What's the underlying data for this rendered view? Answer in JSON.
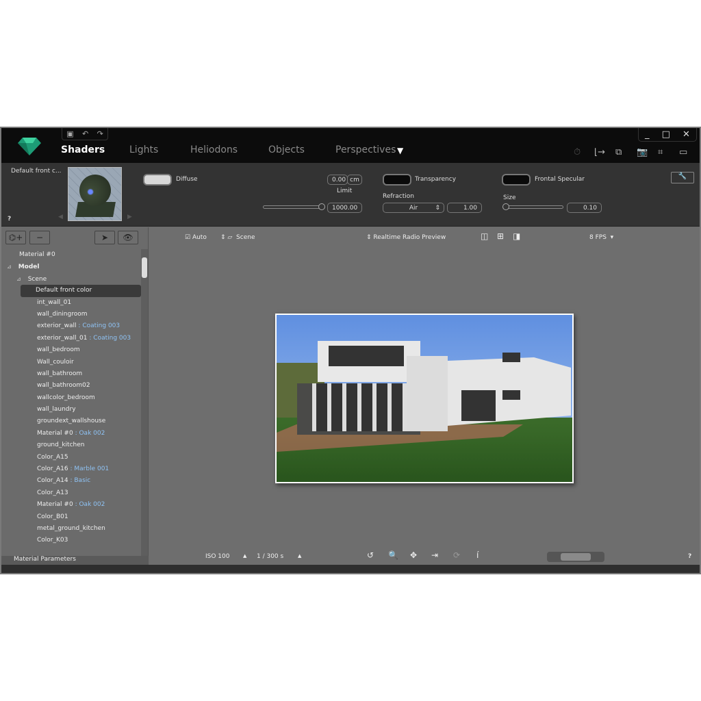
{
  "titlebar": {
    "tabs": [
      "Shaders",
      "Lights",
      "Heliodons",
      "Objects",
      "Perspectives"
    ],
    "active_tab": "Shaders",
    "quick_access": [
      "save-icon",
      "undo-icon",
      "redo-icon"
    ],
    "window_controls": [
      "_",
      "□",
      "✕"
    ],
    "tools": [
      "timer-icon",
      "axes-icon",
      "layers-icon",
      "camera-icon",
      "crop-icon",
      "monitor-icon"
    ]
  },
  "shader": {
    "material_name": "Default front c...",
    "help": "?",
    "diffuse_label": "Diffuse",
    "diffuse_color": "#d8d8d8",
    "limit_value": "0.00",
    "limit_unit": "cm",
    "limit_label": "Limit",
    "limit_slider_value": "1000.00",
    "transparency_label": "Transparency",
    "transparency_color": "#0a0a0a",
    "refraction_label": "Refraction",
    "refraction_option": "Air",
    "refraction_value": "1.00",
    "specular_label": "Frontal Specular",
    "specular_color": "#0a0a0a",
    "size_label": "Size",
    "size_value": "0.10"
  },
  "tree": {
    "items": [
      {
        "label": "Material #0",
        "level": 1
      },
      {
        "label": "Model",
        "level": 0,
        "bold": true,
        "expand": "⊿"
      },
      {
        "label": "Scene",
        "level": 1,
        "expand": "⊿"
      },
      {
        "label": "Default front color",
        "level": 2,
        "selected": true
      },
      {
        "label": "int_wall_01",
        "level": 2
      },
      {
        "label": "wall_diningroom",
        "level": 2
      },
      {
        "label": "exterior_wall",
        "material": "Coating 003",
        "level": 2
      },
      {
        "label": "exterior_wall_01",
        "material": "Coating 003",
        "level": 2
      },
      {
        "label": "wall_bedroom",
        "level": 2
      },
      {
        "label": "Wall_couloir",
        "level": 2
      },
      {
        "label": "wall_bathroom",
        "level": 2
      },
      {
        "label": "wall_bathroom02",
        "level": 2
      },
      {
        "label": "wallcolor_bedroom",
        "level": 2
      },
      {
        "label": "wall_laundry",
        "level": 2
      },
      {
        "label": "groundext_wallshouse",
        "level": 2
      },
      {
        "label": "Material #0",
        "material": "Oak 002",
        "level": 2
      },
      {
        "label": "ground_kitchen",
        "level": 2
      },
      {
        "label": "Color_A15",
        "level": 2
      },
      {
        "label": "Color_A16",
        "material": "Marble 001",
        "level": 2
      },
      {
        "label": "Color_A14",
        "material": "Basic",
        "level": 2
      },
      {
        "label": "Color_A13",
        "level": 2
      },
      {
        "label": "Material #0",
        "material": "Oak 002",
        "level": 2
      },
      {
        "label": "Color_B01",
        "level": 2
      },
      {
        "label": "metal_ground_kitchen",
        "level": 2
      },
      {
        "label": "Color_K03",
        "level": 2
      }
    ],
    "footer": "Material Parameters"
  },
  "viewport": {
    "auto_label": "Auto",
    "auto_checked": true,
    "scene_label": "Scene",
    "mode": "Realtime Radio Preview",
    "fps": "8 FPS",
    "iso": "ISO 100",
    "shutter": "1 / 300 s",
    "help": "?"
  }
}
